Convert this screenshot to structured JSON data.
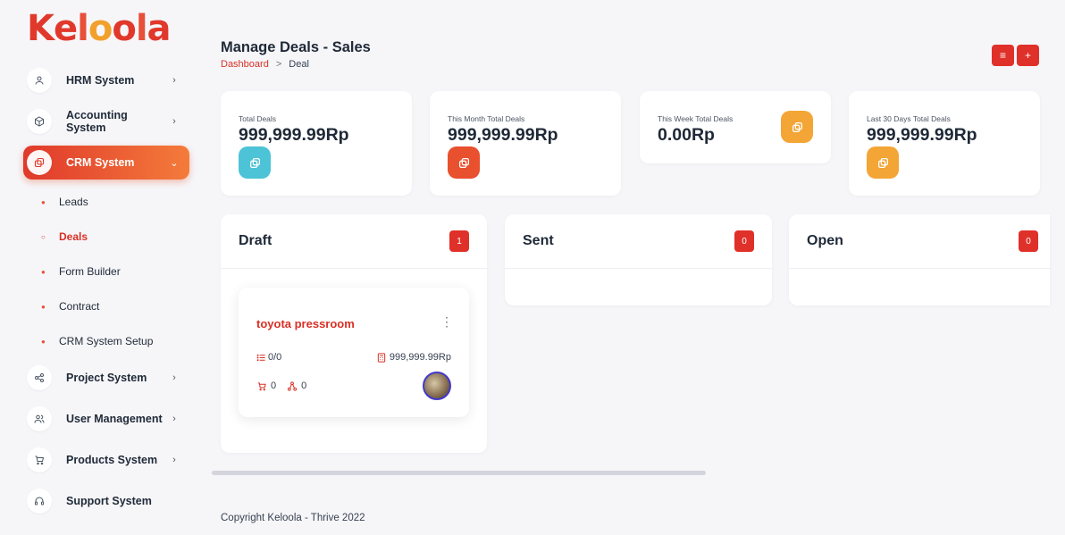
{
  "brand": {
    "letters": [
      {
        "ch": "K",
        "color": "#e0392b"
      },
      {
        "ch": "e",
        "color": "#e0392b"
      },
      {
        "ch": "l",
        "color": "#e8503a"
      },
      {
        "ch": "o",
        "color": "#f2a02c"
      },
      {
        "ch": "o",
        "color": "#e0392b"
      },
      {
        "ch": "l",
        "color": "#e8503a"
      },
      {
        "ch": "a",
        "color": "#e0392b"
      }
    ]
  },
  "sidebar": {
    "items": [
      {
        "label": "HRM System",
        "icon": "user-icon"
      },
      {
        "label": "Accounting System",
        "icon": "box-icon"
      },
      {
        "label": "CRM System",
        "icon": "layers-icon",
        "active": true
      },
      {
        "label": "Project System",
        "icon": "share-icon"
      },
      {
        "label": "User Management",
        "icon": "users-icon"
      },
      {
        "label": "Products System",
        "icon": "cart-icon"
      },
      {
        "label": "Support System",
        "icon": "headphones-icon"
      }
    ],
    "sub_items": [
      {
        "label": "Leads"
      },
      {
        "label": "Deals",
        "current": true
      },
      {
        "label": "Form Builder"
      },
      {
        "label": "Contract"
      },
      {
        "label": "CRM System Setup"
      }
    ]
  },
  "header": {
    "title": "Manage Deals - Sales",
    "breadcrumb": {
      "link": "Dashboard",
      "separator": ">",
      "current": "Deal"
    },
    "buttons": [
      {
        "icon": "list-icon",
        "glyph": "≡"
      },
      {
        "icon": "plus-icon",
        "glyph": "+"
      }
    ]
  },
  "stats": [
    {
      "label": "Total Deals",
      "value": "999,999.99Rp",
      "icon_color": "#4cc3d6"
    },
    {
      "label": "This Month Total Deals",
      "value": "999,999.99Rp",
      "icon_color": "#e8502e"
    },
    {
      "label": "This Week Total Deals",
      "value": "0.00Rp",
      "icon_color": "#f3a536"
    },
    {
      "label": "Last 30 Days Total Deals",
      "value": "999,999.99Rp",
      "icon_color": "#f3a536"
    }
  ],
  "stages": [
    {
      "title": "Draft",
      "count": "1"
    },
    {
      "title": "Sent",
      "count": "0"
    },
    {
      "title": "Open",
      "count": "0"
    }
  ],
  "deal": {
    "name": "toyota pressroom",
    "menu": "⋮",
    "tasks": "0/0",
    "amount": "999,999.99Rp",
    "products": "0",
    "sources": "0"
  },
  "footer": {
    "text": "Copyright Keloola - Thrive 2022"
  }
}
